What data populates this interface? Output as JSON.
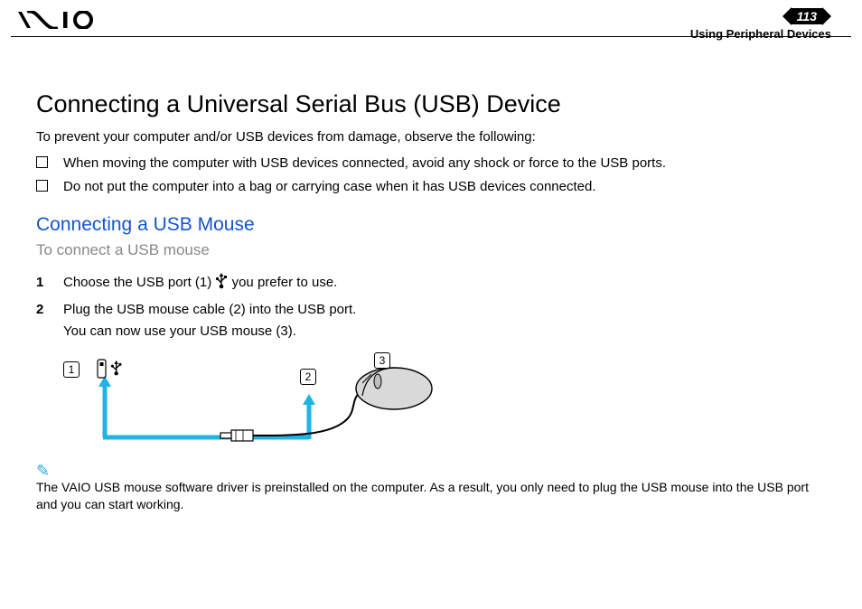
{
  "header": {
    "page_number": "113",
    "section_title": "Using Peripheral Devices"
  },
  "main": {
    "title": "Connecting a Universal Serial Bus (USB) Device",
    "intro": "To prevent your computer and/or USB devices from damage, observe the following:",
    "warnings": [
      "When moving the computer with USB devices connected, avoid any shock or force to the USB ports.",
      "Do not put the computer into a bag or carrying case when it has USB devices connected."
    ],
    "subheading": "Connecting a USB Mouse",
    "procedure_title": "To connect a USB mouse",
    "steps": [
      {
        "num": "1",
        "text_a": "Choose the USB port (1) ",
        "text_b": " you prefer to use."
      },
      {
        "num": "2",
        "text_a": "Plug the USB mouse cable (2) into the USB port.",
        "text_b": "You can now use your USB mouse (3)."
      }
    ],
    "diagram_labels": {
      "l1": "1",
      "l2": "2",
      "l3": "3"
    },
    "note": "The VAIO USB mouse software driver is preinstalled on the computer. As a result, you only need to plug the USB mouse into the USB port and you can start working."
  }
}
